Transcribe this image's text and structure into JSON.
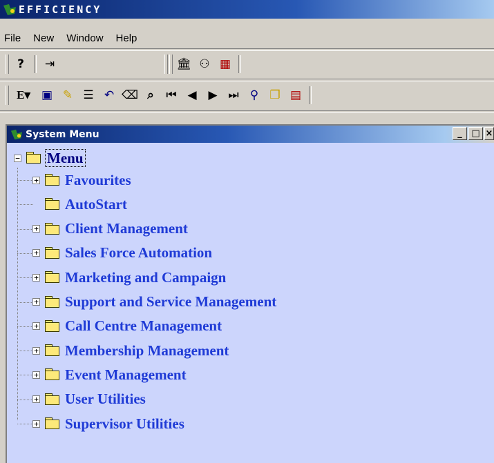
{
  "app": {
    "title": "EFFICIENCY"
  },
  "menubar": [
    "File",
    "New",
    "Window",
    "Help"
  ],
  "toolbar1": [
    {
      "name": "help-icon",
      "glyph": "?"
    },
    {
      "name": "exit-icon",
      "glyph": "⇥"
    }
  ],
  "toolbar2": [
    {
      "name": "building-icon",
      "glyph": "🏛"
    },
    {
      "name": "people-icon",
      "glyph": "⚇"
    },
    {
      "name": "numbers-grid-icon",
      "glyph": "▦"
    }
  ],
  "toolbar3": [
    {
      "name": "edit-dropdown-icon",
      "glyph": "E▾"
    },
    {
      "name": "save-icon",
      "glyph": "▣"
    },
    {
      "name": "clear-brush-icon",
      "glyph": "✎"
    },
    {
      "name": "list-icon",
      "glyph": "☰"
    },
    {
      "name": "undo-icon",
      "glyph": "↶"
    },
    {
      "name": "eraser-icon",
      "glyph": "⌫"
    },
    {
      "name": "find-binoculars-icon",
      "glyph": "⌕"
    },
    {
      "name": "first-record-icon",
      "glyph": "⏮"
    },
    {
      "name": "previous-record-icon",
      "glyph": "◀"
    },
    {
      "name": "next-record-icon",
      "glyph": "▶"
    },
    {
      "name": "last-record-icon",
      "glyph": "⏭"
    },
    {
      "name": "search-person-icon",
      "glyph": "⚲"
    },
    {
      "name": "cards-icon",
      "glyph": "❐"
    },
    {
      "name": "form-icon",
      "glyph": "▤"
    }
  ],
  "system_menu": {
    "title": "System Menu",
    "buttons": {
      "minimize": "_",
      "maximize": "□",
      "close": "×"
    },
    "root": {
      "label": "Menu",
      "expander": "−"
    },
    "items": [
      {
        "label": "Favourites",
        "expandable": true
      },
      {
        "label": "AutoStart",
        "expandable": false
      },
      {
        "label": "Client Management",
        "expandable": true
      },
      {
        "label": "Sales Force Automation",
        "expandable": true
      },
      {
        "label": "Marketing and Campaign",
        "expandable": true
      },
      {
        "label": "Support and Service Management",
        "expandable": true
      },
      {
        "label": "Call Centre Management",
        "expandable": true
      },
      {
        "label": "Membership Management",
        "expandable": true
      },
      {
        "label": "Event Management",
        "expandable": true
      },
      {
        "label": "User Utilities",
        "expandable": true
      },
      {
        "label": "Supervisor Utilities",
        "expandable": true
      }
    ],
    "expander_collapsed": "+"
  }
}
